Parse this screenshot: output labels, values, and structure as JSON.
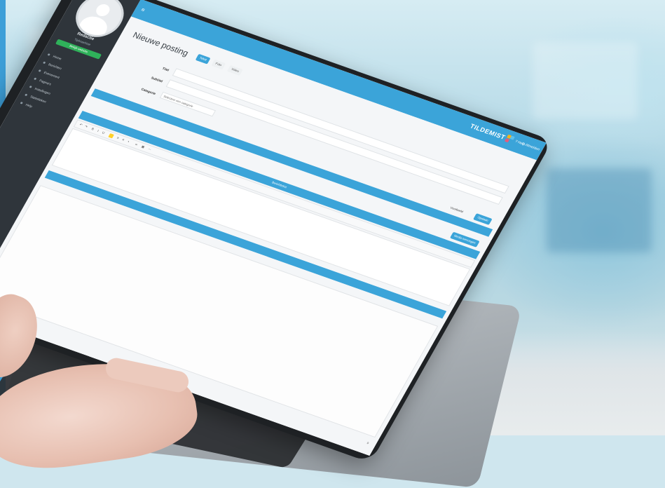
{
  "sidebar": {
    "user_name": "Redactie",
    "user_role": "Tijdmachine",
    "user_button": "Bekijk website",
    "items": [
      "Home",
      "Berichten",
      "Evenement",
      "Pagina's",
      "Instellingen",
      "Statistieken",
      "Help"
    ]
  },
  "topbar": {
    "brand": "TILDEMIST",
    "help": "Help",
    "logout": "Afmelden",
    "colors": {
      "primary": "#3ba4d9",
      "sidebar": "#2f353b"
    }
  },
  "page": {
    "title": "Nieuwe posting",
    "tabs": [
      "Tekst",
      "Foto",
      "Video"
    ],
    "labels": {
      "title": "Titel",
      "subtitle": "Subtitel",
      "category": "Categorie"
    },
    "placeholders": {
      "title": "",
      "subtitle": ""
    },
    "category_select": "Selecteer een categorie",
    "buttons": {
      "preview": "Voorbeeld",
      "save": "Opslaan",
      "add_media": "Media toevoegen"
    },
    "editor_bar": "Berichttekst",
    "counter": "0"
  },
  "icons": [
    "menu-icon",
    "user-icon",
    "help-icon",
    "logout-icon"
  ]
}
